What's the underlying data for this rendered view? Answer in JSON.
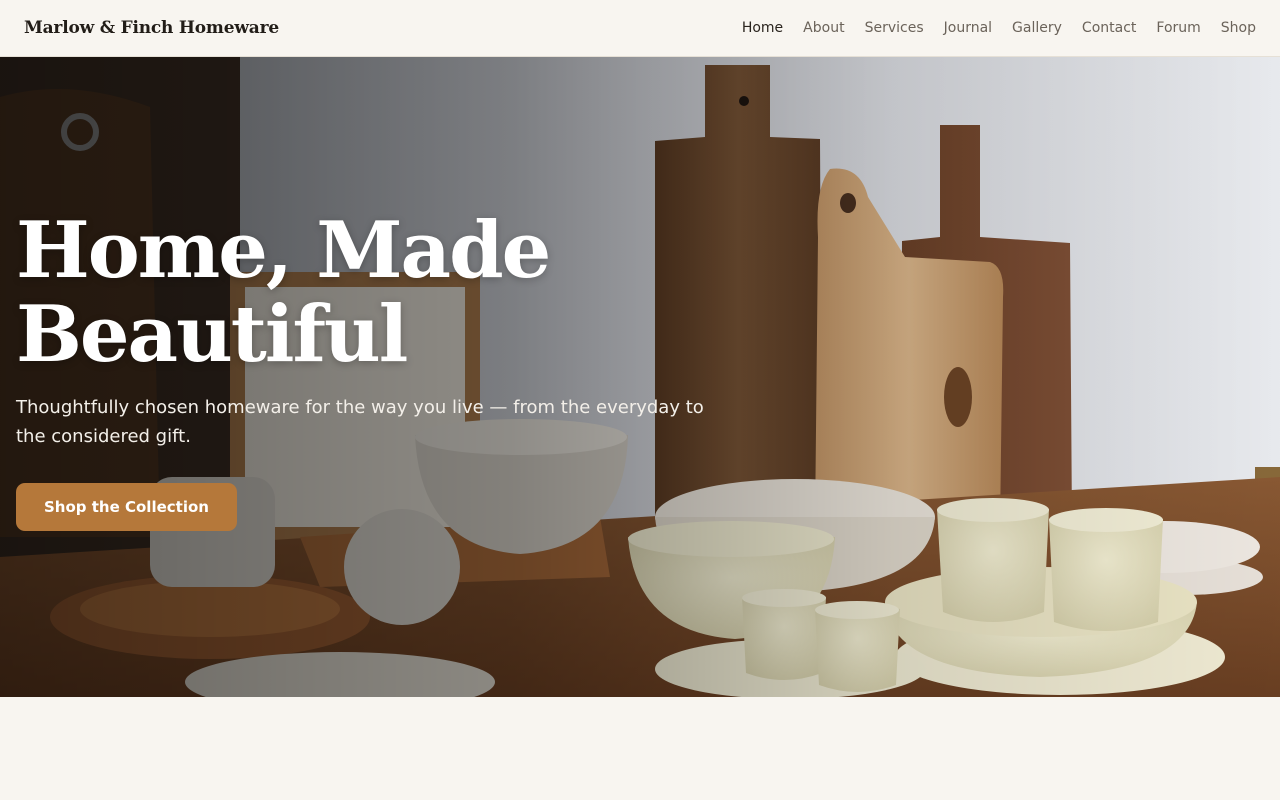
{
  "header": {
    "brand": "Marlow & Finch Homeware",
    "nav": [
      {
        "label": "Home",
        "active": true
      },
      {
        "label": "About"
      },
      {
        "label": "Services"
      },
      {
        "label": "Journal"
      },
      {
        "label": "Gallery"
      },
      {
        "label": "Contact"
      },
      {
        "label": "Forum"
      },
      {
        "label": "Shop"
      }
    ]
  },
  "hero": {
    "headline": "Home, Made Beautiful",
    "subtitle": "Thoughtfully chosen homeware for the way you live — from the everyday to the considered gift.",
    "cta_label": "Shop the Collection"
  },
  "colors": {
    "accent": "#b5783a",
    "background": "#f8f5f0",
    "text_dark": "#221d18"
  }
}
